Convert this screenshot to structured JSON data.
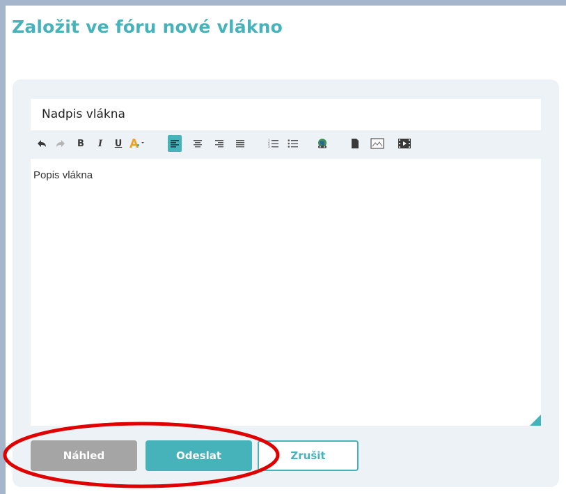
{
  "page": {
    "title": "Založit ve fóru nové vlákno"
  },
  "form": {
    "subject_value": "Nadpis vlákna",
    "body_value": "Popis vlákna"
  },
  "toolbar": {
    "items": [
      "undo-icon",
      "redo-icon",
      "bold",
      "italic",
      "underline",
      "text-color-icon",
      "align-left-icon",
      "align-center-icon",
      "align-right-icon",
      "align-justify-icon",
      "ordered-list-icon",
      "unordered-list-icon",
      "link-icon",
      "document-icon",
      "image-icon",
      "video-icon"
    ],
    "bold_label": "B",
    "italic_label": "I",
    "underline_label": "U",
    "active_item": "align-left-icon"
  },
  "buttons": {
    "preview_label": "Náhled",
    "send_label": "Odeslat",
    "cancel_label": "Zrušit"
  },
  "colors": {
    "accent": "#46b3bb",
    "panel": "#edf2f6",
    "frame": "#a5b5cb",
    "annotation": "#e00000",
    "preview_button": "#a5a5a5"
  }
}
